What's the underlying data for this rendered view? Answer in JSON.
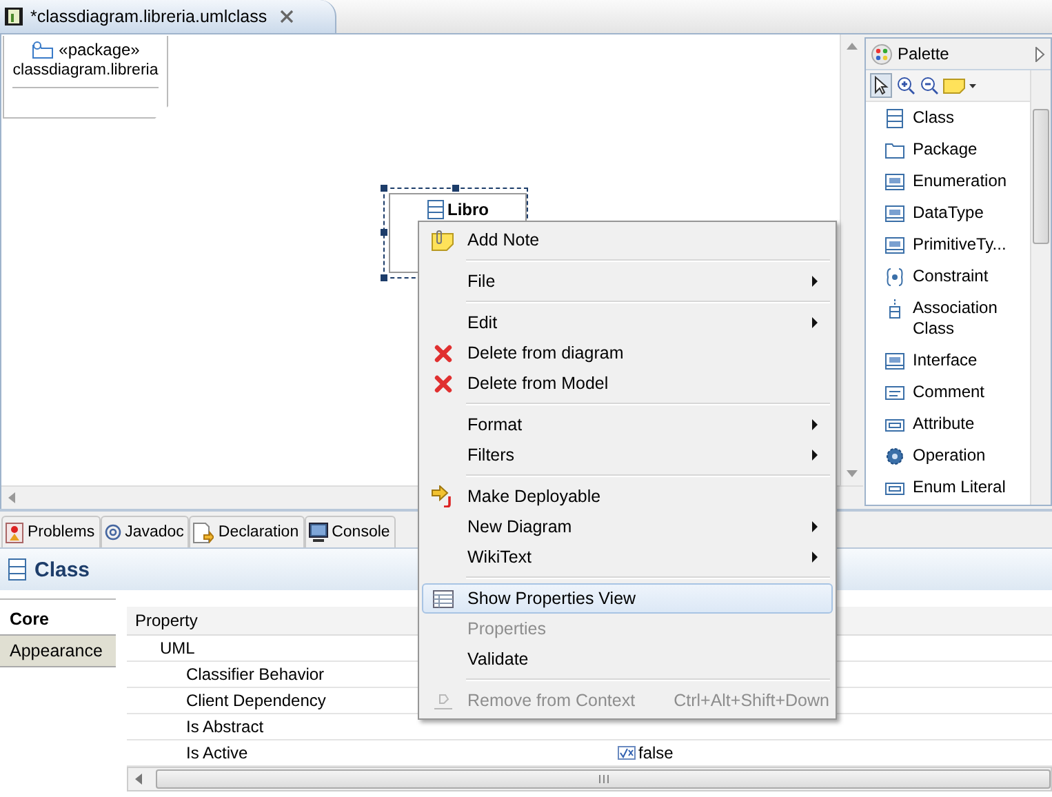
{
  "editor_tab": {
    "title": "*classdiagram.libreria.umlclass"
  },
  "diagram": {
    "package_node": {
      "stereotype": "«package»",
      "name": "classdiagram.libreria"
    },
    "class_node": {
      "name": "Libro",
      "selected": true
    }
  },
  "palette": {
    "title": "Palette",
    "tools": [
      {
        "label": "Class"
      },
      {
        "label": "Package"
      },
      {
        "label": "Enumeration"
      },
      {
        "label": "DataType"
      },
      {
        "label": "PrimitiveTy..."
      },
      {
        "label": "Constraint"
      },
      {
        "label": "Association Class"
      },
      {
        "label": "Interface"
      },
      {
        "label": "Comment"
      },
      {
        "label": "Attribute"
      },
      {
        "label": "Operation"
      },
      {
        "label": "Enum Literal"
      }
    ]
  },
  "bottom_tabs": [
    {
      "label": "Problems"
    },
    {
      "label": "Javadoc"
    },
    {
      "label": "Declaration"
    },
    {
      "label": "Console"
    }
  ],
  "properties": {
    "title": "Class",
    "side_tabs": [
      {
        "label": "Core",
        "selected": true
      },
      {
        "label": "Appearance",
        "selected": false
      }
    ],
    "column": "Property",
    "rows": [
      {
        "label": "UML",
        "children": [
          {
            "label": "Classifier Behavior"
          },
          {
            "label": "Client Dependency"
          },
          {
            "label": "Is Abstract"
          },
          {
            "label": "Is Active",
            "value": "false"
          }
        ]
      }
    ]
  },
  "context_menu": {
    "items": [
      {
        "kind": "command",
        "label": "Add Note",
        "disabled": false,
        "highlighted": false
      },
      {
        "kind": "separator"
      },
      {
        "kind": "submenu",
        "label": "File",
        "disabled": false,
        "highlighted": false
      },
      {
        "kind": "separator"
      },
      {
        "kind": "submenu",
        "label": "Edit",
        "disabled": false,
        "highlighted": false
      },
      {
        "kind": "command",
        "label": "Delete from diagram",
        "disabled": false,
        "highlighted": false
      },
      {
        "kind": "command",
        "label": "Delete from Model",
        "disabled": false,
        "highlighted": false
      },
      {
        "kind": "separator"
      },
      {
        "kind": "submenu",
        "label": "Format",
        "disabled": false,
        "highlighted": false
      },
      {
        "kind": "submenu",
        "label": "Filters",
        "disabled": false,
        "highlighted": false
      },
      {
        "kind": "separator"
      },
      {
        "kind": "command",
        "label": "Make Deployable",
        "disabled": false,
        "highlighted": false
      },
      {
        "kind": "submenu",
        "label": "New Diagram",
        "disabled": false,
        "highlighted": false
      },
      {
        "kind": "submenu",
        "label": "WikiText",
        "disabled": false,
        "highlighted": false
      },
      {
        "kind": "separator"
      },
      {
        "kind": "command",
        "label": "Show Properties View",
        "disabled": false,
        "highlighted": true
      },
      {
        "kind": "command",
        "label": "Properties",
        "disabled": true,
        "highlighted": false
      },
      {
        "kind": "command",
        "label": "Validate",
        "disabled": false,
        "highlighted": false
      },
      {
        "kind": "separator"
      },
      {
        "kind": "command",
        "label": "Remove from Context",
        "shortcut": "Ctrl+Alt+Shift+Down",
        "disabled": true,
        "highlighted": false
      }
    ]
  }
}
